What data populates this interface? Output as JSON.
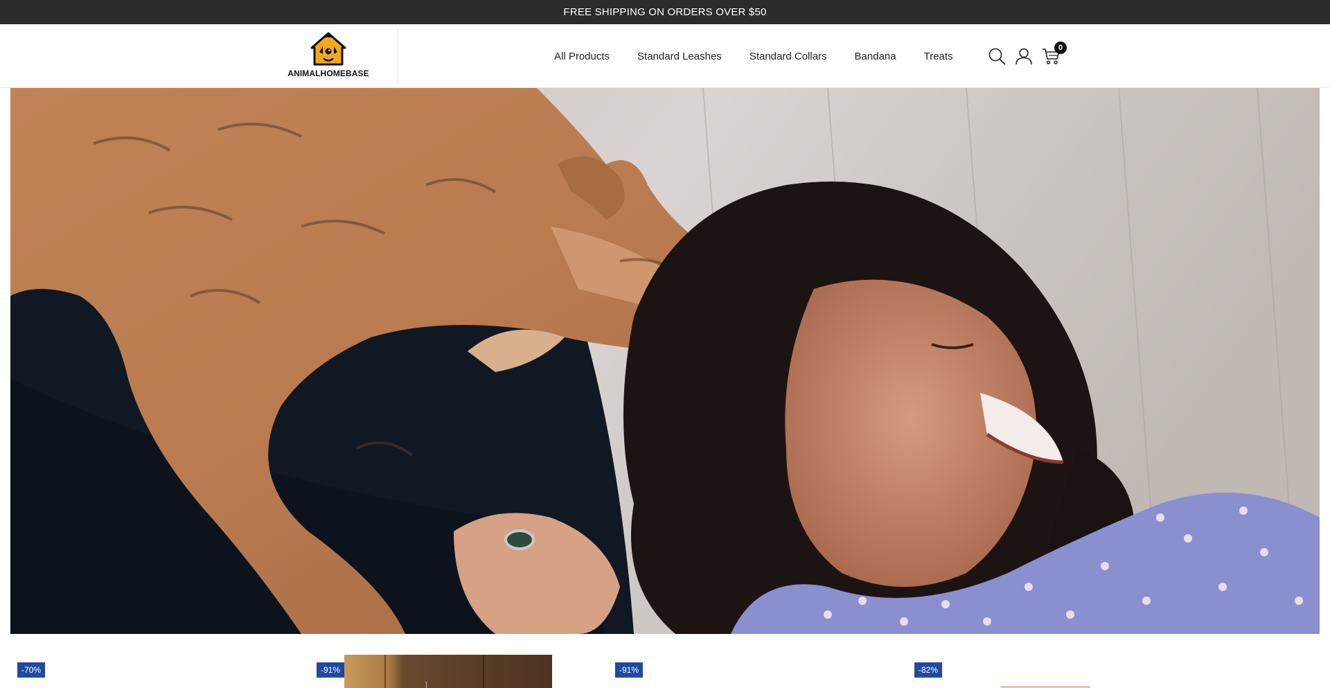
{
  "announcement": {
    "text": "FREE SHIPPING ON ORDERS OVER $50"
  },
  "brand": {
    "name": "ANIMALHOMEBASE",
    "accent": "#f4a81c"
  },
  "nav": {
    "items": [
      {
        "label": "All Products"
      },
      {
        "label": "Standard Leashes"
      },
      {
        "label": "Standard Collars"
      },
      {
        "label": "Bandana"
      },
      {
        "label": "Treats"
      }
    ]
  },
  "header_icons": {
    "search": "search-icon",
    "account": "user-icon",
    "cart": "cart-icon",
    "cart_count": "0"
  },
  "hero": {
    "image": "dog nuzzling laughing woman lying on wooden floor"
  },
  "products": {
    "badge_color": "#1f4aa0",
    "badges": [
      "-70%",
      "-91%",
      "-91%",
      "-82%"
    ]
  }
}
